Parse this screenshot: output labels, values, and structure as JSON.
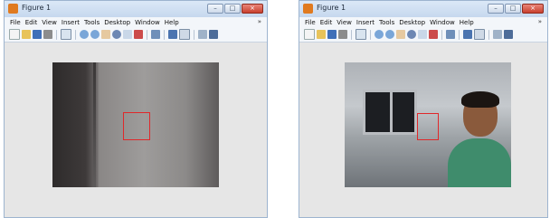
{
  "windows": [
    {
      "title": "Figure 1",
      "menu": [
        "File",
        "Edit",
        "View",
        "Insert",
        "Tools",
        "Desktop",
        "Window",
        "Help"
      ],
      "menu_overflow": "»",
      "buttons": {
        "minimize": "–",
        "maximize": "□",
        "close": "×"
      }
    },
    {
      "title": "Figure 1",
      "menu": [
        "File",
        "Edit",
        "View",
        "Insert",
        "Tools",
        "Desktop",
        "Window",
        "Help"
      ],
      "menu_overflow": "»",
      "buttons": {
        "minimize": "–",
        "maximize": "□",
        "close": "×"
      }
    }
  ],
  "toolbar_icons": [
    "new-figure-icon",
    "open-file-icon",
    "save-icon",
    "print-icon",
    "edit-plot-icon",
    "zoom-in-icon",
    "zoom-out-icon",
    "pan-icon",
    "rotate-3d-icon",
    "data-cursor-icon",
    "brush-icon",
    "link-icon",
    "colorbar-icon",
    "legend-icon",
    "hide-plot-tools-icon",
    "show-plot-tools-icon"
  ],
  "colors": {
    "roi_box": "#e0282a",
    "titlebar": "#c6d8ee",
    "close_button": "#c9402e"
  }
}
